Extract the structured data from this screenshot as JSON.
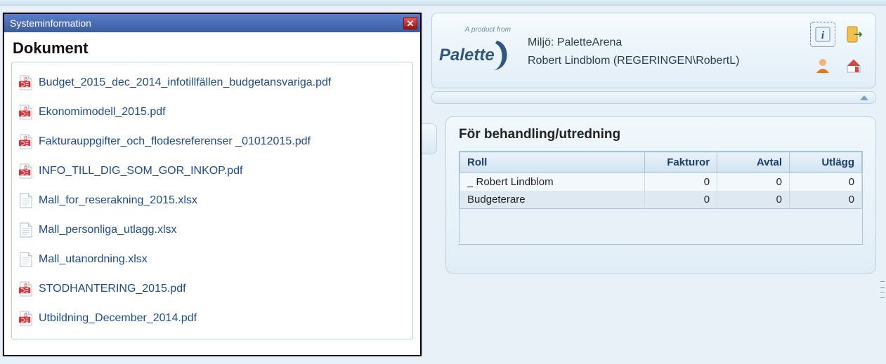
{
  "dialog": {
    "title": "Systeminformation",
    "heading": "Dokument",
    "documents": [
      {
        "name": "Budget_2015_dec_2014_infotillfällen_budgetansvariga.pdf",
        "type": "pdf"
      },
      {
        "name": "Ekonomimodell_2015.pdf",
        "type": "pdf"
      },
      {
        "name": "Fakturauppgifter_och_flodesreferenser _01012015.pdf",
        "type": "pdf"
      },
      {
        "name": "INFO_TILL_DIG_SOM_GOR_INKOP.pdf",
        "type": "pdf"
      },
      {
        "name": "Mall_for_reserakning_2015.xlsx",
        "type": "xlsx"
      },
      {
        "name": "Mall_personliga_utlagg.xlsx",
        "type": "xlsx"
      },
      {
        "name": "Mall_utanordning.xlsx",
        "type": "xlsx"
      },
      {
        "name": "STODHANTERING_2015.pdf",
        "type": "pdf"
      },
      {
        "name": "Utbildning_December_2014.pdf",
        "type": "pdf"
      }
    ]
  },
  "header": {
    "product_tag": "A product from",
    "brand": "Palette",
    "env_label": "Miljö: ",
    "env_value": "PaletteArena",
    "user": "Robert Lindblom (REGERINGEN\\RobertL)"
  },
  "panel": {
    "title": "För behandling/utredning",
    "columns": [
      "Roll",
      "Fakturor",
      "Avtal",
      "Utlägg"
    ],
    "rows": [
      {
        "roll": "_ Robert Lindblom",
        "fakturor": 0,
        "avtal": 0,
        "utlagg": 0
      },
      {
        "roll": "Budgeterare",
        "fakturor": 0,
        "avtal": 0,
        "utlagg": 0
      }
    ]
  }
}
